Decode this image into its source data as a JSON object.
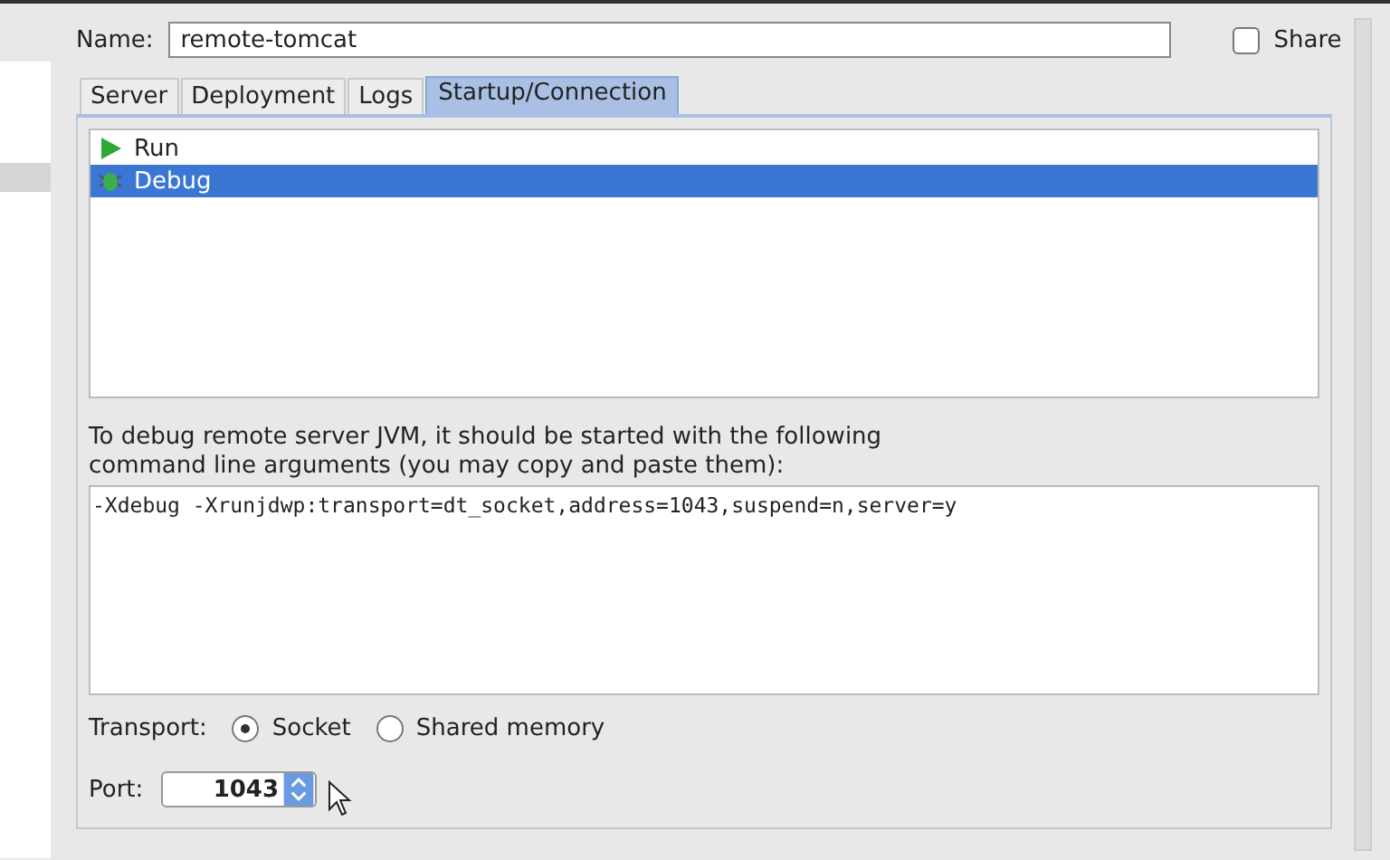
{
  "sidebar": {
    "items": [
      {
        "selected": true
      }
    ]
  },
  "name_field": {
    "label": "Name:",
    "value": "remote-tomcat"
  },
  "share": {
    "label": "Share",
    "checked": false
  },
  "tabs": [
    {
      "label": "Server",
      "selected": false
    },
    {
      "label": "Deployment",
      "selected": false
    },
    {
      "label": "Logs",
      "selected": false
    },
    {
      "label": "Startup/Connection",
      "selected": true
    }
  ],
  "modes": [
    {
      "kind": "run",
      "label": "Run",
      "selected": false
    },
    {
      "kind": "debug",
      "label": "Debug",
      "selected": true
    }
  ],
  "description": "To debug remote server JVM, it should be started with the following command line arguments (you may copy and paste them):",
  "arguments": "-Xdebug -Xrunjdwp:transport=dt_socket,address=1043,suspend=n,server=y",
  "transport": {
    "label": "Transport:",
    "options": [
      {
        "label": "Socket",
        "selected": true
      },
      {
        "label": "Shared memory",
        "selected": false
      }
    ]
  },
  "port": {
    "label": "Port:",
    "value": "1043"
  }
}
